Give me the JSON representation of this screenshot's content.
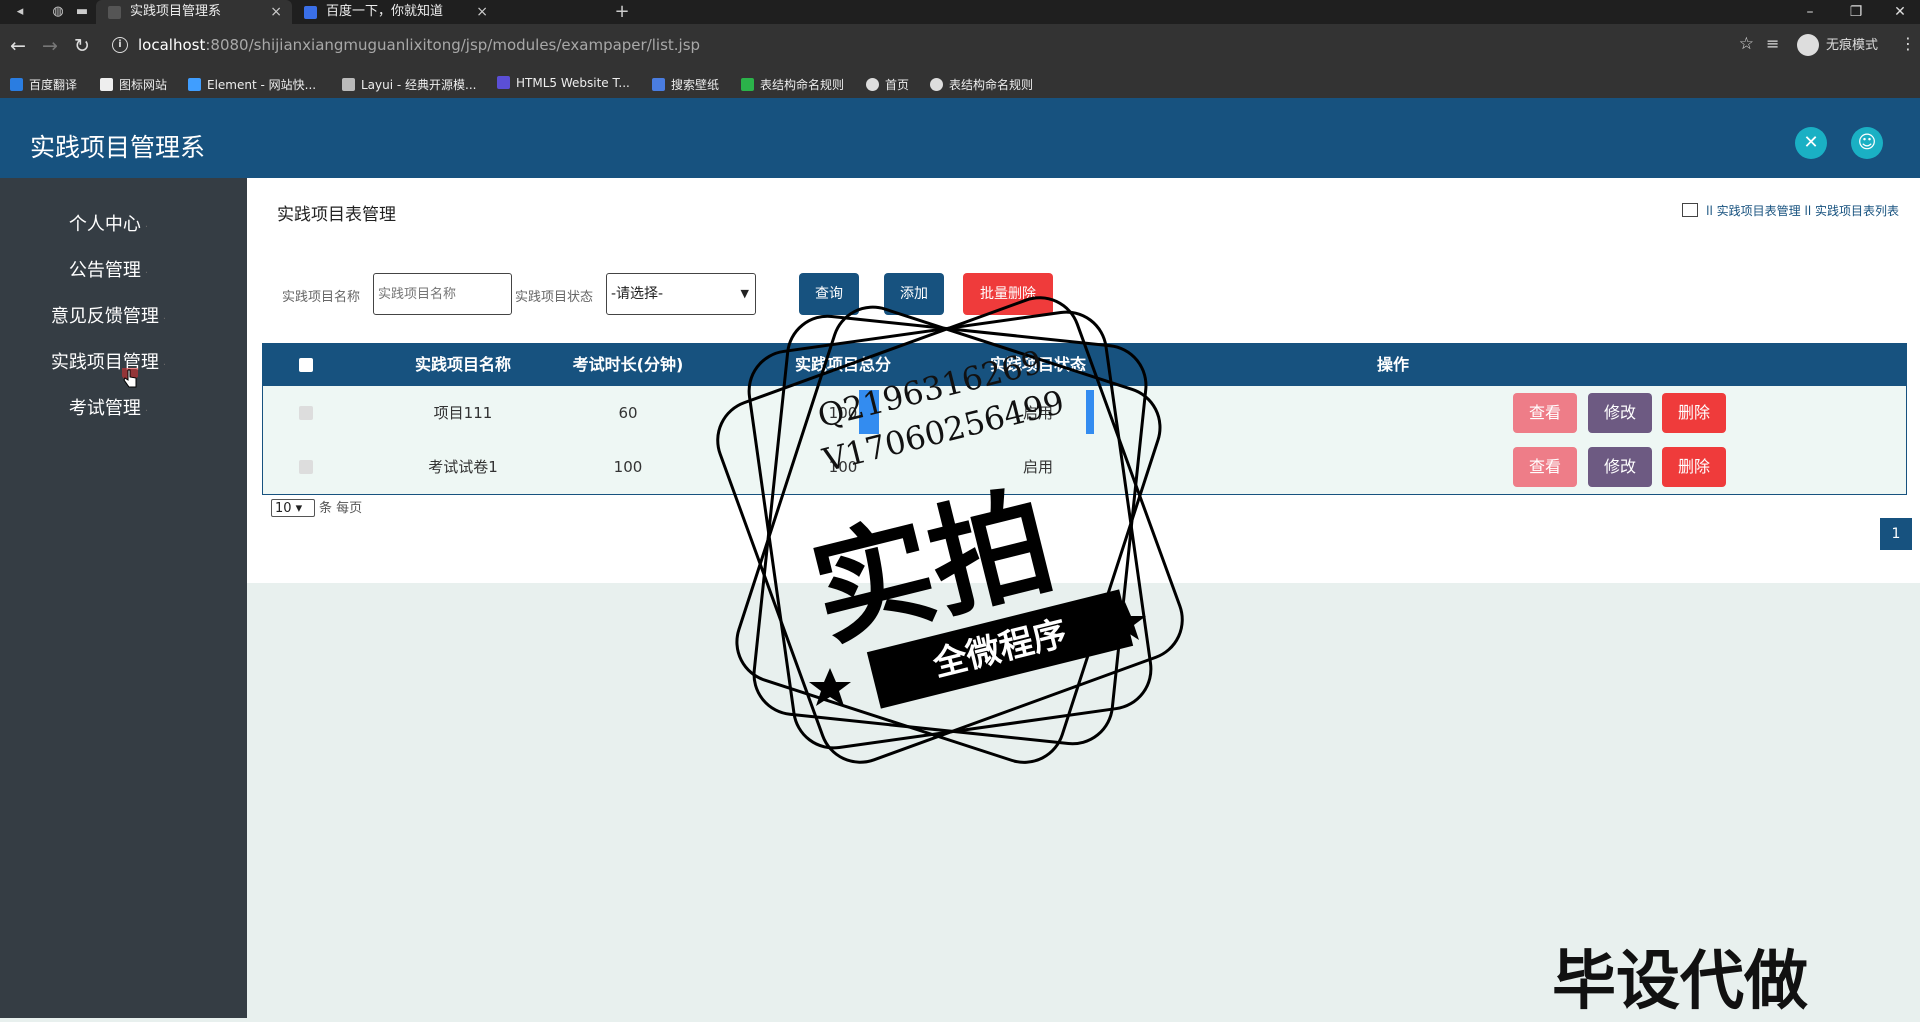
{
  "browser": {
    "tabs": [
      {
        "title": "实践项目管理系"
      },
      {
        "title": "百度一下，你就知道"
      }
    ],
    "url_host": "localhost",
    "url_path": ":8080/shijianxiangmuguanlixitong/jsp/modules/exampaper/list.jsp",
    "incognito_label": "无痕模式",
    "bookmarks": [
      {
        "label": "百度翻译",
        "color": "#2a7de1"
      },
      {
        "label": "图标网站",
        "color": "#eeeeee"
      },
      {
        "label": "Element - 网站快...",
        "color": "#409eff"
      },
      {
        "label": "Layui - 经典开源模...",
        "color": "#bbbbbb"
      },
      {
        "label": "HTML5 Website T...",
        "color": "#5b4fd6"
      },
      {
        "label": "搜索壁纸",
        "color": "#4a7de1"
      },
      {
        "label": "表结构命名规则",
        "color": "#2bb34a"
      },
      {
        "label": "首页",
        "color": "#dddddd"
      },
      {
        "label": "表结构命名规则",
        "color": "#dddddd"
      }
    ]
  },
  "app": {
    "title": "实践项目管理系",
    "sidebar": [
      {
        "label": "个人中心"
      },
      {
        "label": "公告管理"
      },
      {
        "label": "意见反馈管理"
      },
      {
        "label": "实践项目管理"
      },
      {
        "label": "考试管理"
      }
    ]
  },
  "page": {
    "title": "实践项目表管理",
    "breadcrumb": [
      "实践项目表管理",
      "实践项目表列表"
    ],
    "search": {
      "name_label": "实践项目名称",
      "name_placeholder": "实践项目名称",
      "status_label": "实践项目状态",
      "status_value": "-请选择-"
    },
    "buttons": {
      "query": "查询",
      "add": "添加",
      "bulk_delete": "批量删除"
    },
    "table": {
      "headers": [
        "实践项目名称",
        "考试时长(分钟)",
        "实践项目总分",
        "实践项目状态",
        "操作"
      ],
      "rows": [
        {
          "name": "项目111",
          "duration": "60",
          "score": "100",
          "status": "启用"
        },
        {
          "name": "考试试卷1",
          "duration": "100",
          "score": "100",
          "status": "启用"
        }
      ],
      "actions": {
        "view": "查看",
        "edit": "修改",
        "delete": "删除"
      }
    },
    "pagination": {
      "page_size": "10",
      "page_size_suffix": "条 每页",
      "current_page": "1"
    }
  },
  "watermark": {
    "line1": "Q2196316269",
    "line2": "V17060256499",
    "big": "实拍",
    "band": "全微程序",
    "corner": "毕设代做"
  }
}
